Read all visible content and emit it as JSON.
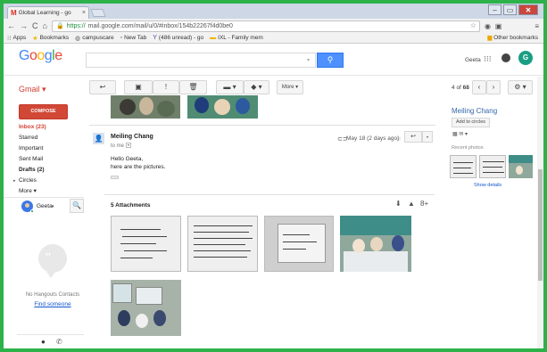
{
  "browser": {
    "tab_title": "Global Learning - go",
    "tab_close": "×",
    "url_scheme": "https://",
    "url_rest": "mail.google.com/mail/u/0/#inbox/154b22267f4d0be0",
    "window_min": "–",
    "window_max": "▭",
    "window_close": "✕"
  },
  "bookmarks": {
    "items": [
      {
        "label": "Apps",
        "icon": "apps-grid-icon"
      },
      {
        "label": "Bookmarks",
        "icon": "star-icon"
      },
      {
        "label": "campuscare",
        "icon": "globe-icon"
      },
      {
        "label": "New Tab",
        "icon": "page-icon"
      },
      {
        "label": "(486 unread) - go",
        "icon": "yahoo-icon"
      },
      {
        "label": "IXL - Family mem",
        "icon": "ixl-icon"
      }
    ],
    "other": "Other bookmarks"
  },
  "gmail": {
    "logo": [
      "G",
      "o",
      "o",
      "g",
      "l",
      "e"
    ],
    "product_label": "Gmail ▾",
    "search_placeholder": "",
    "user_name": "Geeta",
    "avatar_letter": "G",
    "toolbar": {
      "back": "↩",
      "archive": "▣",
      "report": "!",
      "delete": "🗑",
      "move": "▬ ▾",
      "labels": "◆ ▾",
      "more": "More ▾",
      "settings": "⚙ ▾"
    },
    "pager": {
      "range": "4",
      "of": "of",
      "total": "68",
      "prev": "‹",
      "next": "›"
    }
  },
  "sidebar": {
    "compose": "COMPOSE",
    "items": [
      {
        "label": "Inbox (23)",
        "state": "active"
      },
      {
        "label": "Starred",
        "state": ""
      },
      {
        "label": "Important",
        "state": ""
      },
      {
        "label": "Sent Mail",
        "state": ""
      },
      {
        "label": "Drafts (2)",
        "state": "bold"
      },
      {
        "label": "Circles",
        "state": "caret"
      },
      {
        "label": "More ▾",
        "state": ""
      }
    ],
    "hangouts": {
      "me": "Geeta",
      "me_drop": "▾",
      "search": "🔍",
      "no_contacts": "No Hangouts Contacts",
      "find": "Find someone"
    }
  },
  "message": {
    "sender": "Meiling Chang",
    "to": "to me",
    "to_drop": "▾",
    "date": "May 18 (2 days ago)",
    "star": "☆",
    "reply": "↩",
    "more": "▾",
    "body": [
      "Hello Geeta,",
      "here are the pictures."
    ]
  },
  "attachments": {
    "title": "5 Attachments",
    "download_all": "⬇",
    "save_drive": "▲",
    "share_gplus": "8+"
  },
  "right_panel": {
    "name": "Meiling Chang",
    "add_button": "Add to circles",
    "icons": "▦ ✉ ▾",
    "recent_photos": "Recent photos",
    "show_details": "Show details"
  }
}
